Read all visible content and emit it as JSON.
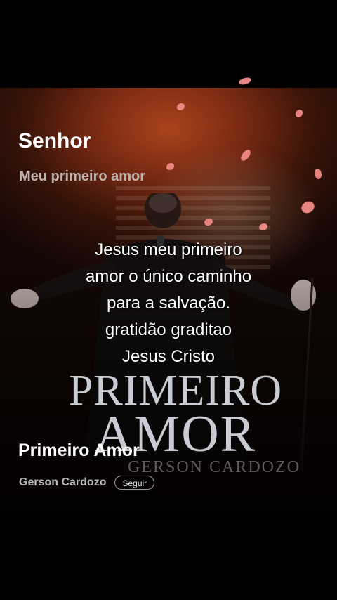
{
  "header": {
    "song_title": "Senhor",
    "song_subtitle": "Meu primeiro amor"
  },
  "caption": {
    "lines": [
      "Jesus meu primeiro",
      "amor o único caminho",
      "para a salvação.",
      "gratidão graditao",
      "Jesus Cristo"
    ]
  },
  "album_art": {
    "line1": "PRIMEIRO",
    "line2": "AMOR",
    "line3": "GERSON CARDOZO"
  },
  "footer": {
    "track_name": "Primeiro Amor",
    "artist_name": "Gerson Cardozo",
    "follow_label": "Seguir"
  },
  "colors": {
    "background": "#000000",
    "accent_orange": "#b0451d",
    "petal": "#f08a86",
    "text_primary": "#ffffff",
    "text_secondary": "#bdb3ae"
  }
}
